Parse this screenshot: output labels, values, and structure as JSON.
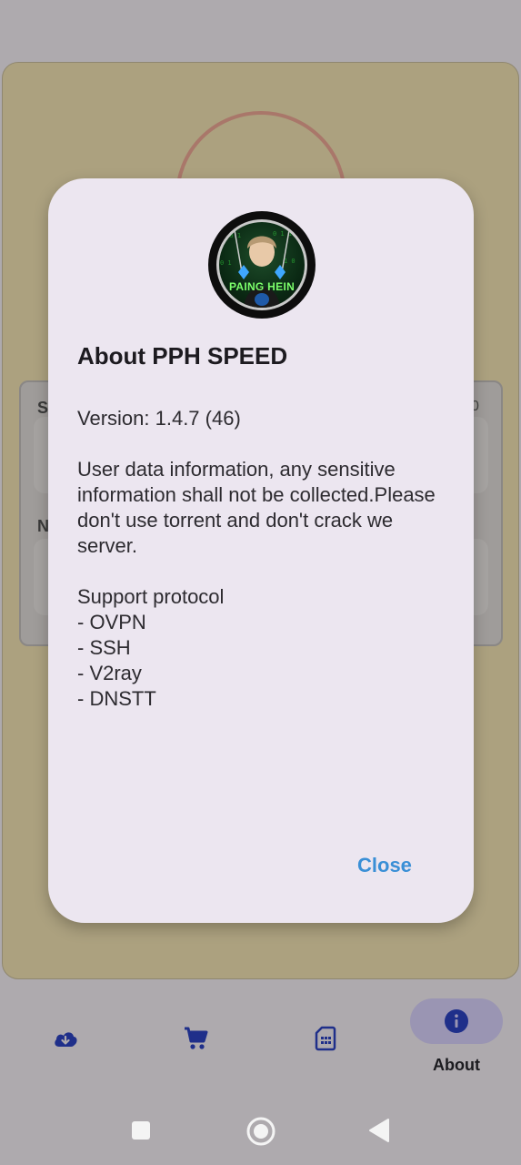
{
  "background": {
    "panel_letter_1": "S",
    "panel_letter_2": "N",
    "panel_value": "0"
  },
  "dialog": {
    "avatar_text": "PAING HEIN",
    "title": "About PPH SPEED",
    "version_line": "Version:  1.4.7 (46)",
    "description": "User data information, any sensitive information shall not be collected.Please don't use torrent and don't crack we server.",
    "protocol_header": "Support protocol",
    "protocols": [
      "- OVPN",
      "- SSH",
      "- V2ray",
      "- DNSTT"
    ],
    "close_label": "Close"
  },
  "bottom_nav": {
    "items": [
      {
        "name": "download",
        "icon": "cloud-download-icon"
      },
      {
        "name": "shop",
        "icon": "cart-icon"
      },
      {
        "name": "sim",
        "icon": "sim-card-icon"
      },
      {
        "name": "about",
        "icon": "info-icon",
        "label": "About",
        "active": true
      }
    ],
    "active_color": "#1f2f8a"
  },
  "system_nav": {
    "buttons": [
      "recents-icon",
      "home-icon",
      "back-icon"
    ]
  }
}
